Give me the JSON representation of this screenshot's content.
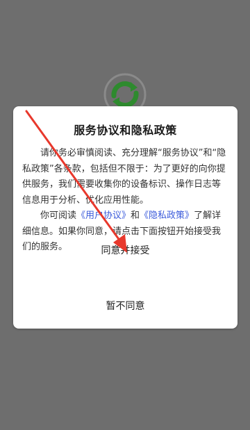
{
  "background": {
    "color": "#6e6e6e"
  },
  "logo": {
    "icon": "sync-refresh-icon",
    "color": "#2e9e34"
  },
  "dialog": {
    "title": "服务协议和隐私政策",
    "para1": "请你务必审慎阅读、充分理解“服务协议”和“隐私政策”各条款，包括但不限于：为了更好的向你提供服务，我们需要收集你的设备标识、操作日志等信息用于分析、优化应用性能。",
    "para2_a": "你可阅读",
    "user_agreement_link": "《用户协议》",
    "para2_and": "和",
    "privacy_policy_link": "《隐私政策》",
    "para2_b": "了解详细信息。如果你同意，请点击下面按钮开始接受我们的服务。",
    "agree_label": "同意并接受",
    "disagree_label": "暂不同意"
  },
  "annotation": {
    "icon": "red-arrow-pointer",
    "color": "#e8382c"
  }
}
